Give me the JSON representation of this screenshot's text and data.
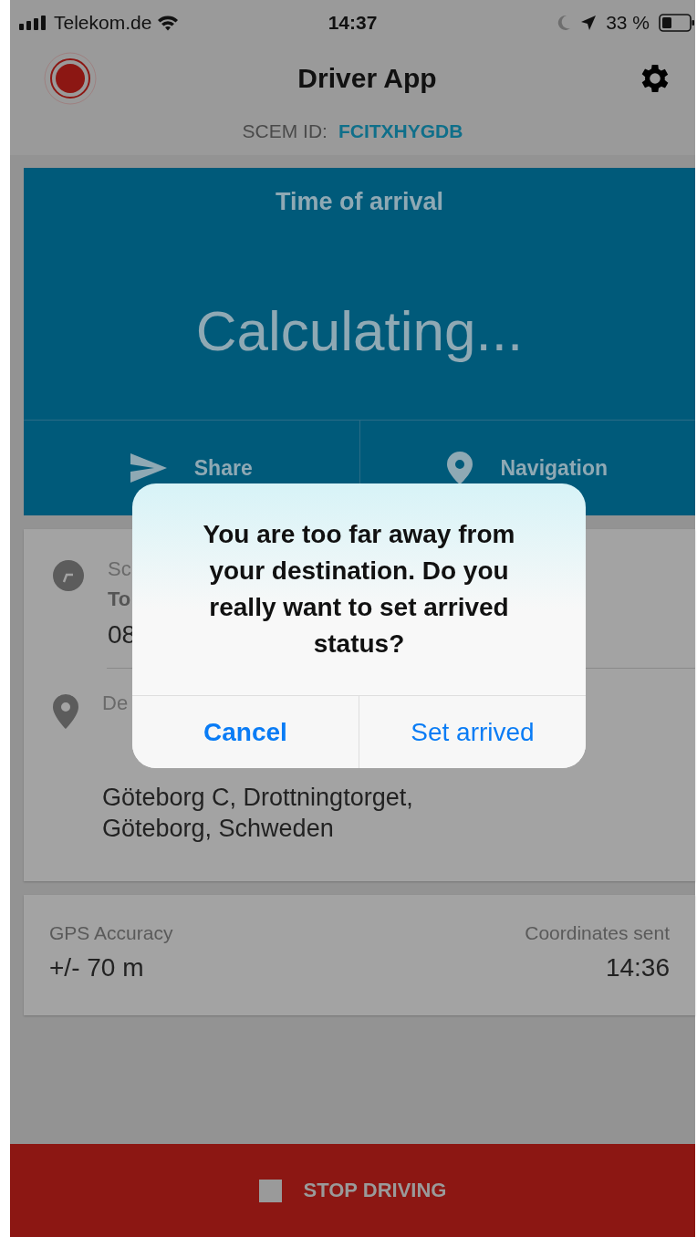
{
  "status_bar": {
    "carrier": "Telekom.de",
    "time": "14:37",
    "battery": "33 %"
  },
  "header": {
    "title": "Driver App",
    "id_label": "SCEM ID:",
    "id_value": "FCITXHYGDB"
  },
  "arrival_card": {
    "title": "Time of arrival",
    "value": "Calculating...",
    "actions": [
      {
        "label": "Share",
        "kind": "share"
      },
      {
        "label": "Navigation",
        "kind": "navigation"
      }
    ]
  },
  "details_card": {
    "schedule_label": "Sc",
    "schedule_sub": "To",
    "schedule_value": "08",
    "destination_label": "De",
    "address_lines": [
      "Göteborg C, Drottningtorget,",
      "Göteborg, Schweden"
    ]
  },
  "gps_card": {
    "left_label": "GPS Accuracy",
    "left_value": "+/- 70 m",
    "right_label": "Coordinates sent",
    "right_value": "14:36"
  },
  "stop_button": {
    "label": "STOP DRIVING"
  },
  "dialog": {
    "message": "You are too far away from your destination. Do you really want to set arrived status?",
    "buttons": [
      {
        "label": "Cancel",
        "kind": "cancel"
      },
      {
        "label": "Set arrived",
        "kind": "default"
      }
    ]
  }
}
